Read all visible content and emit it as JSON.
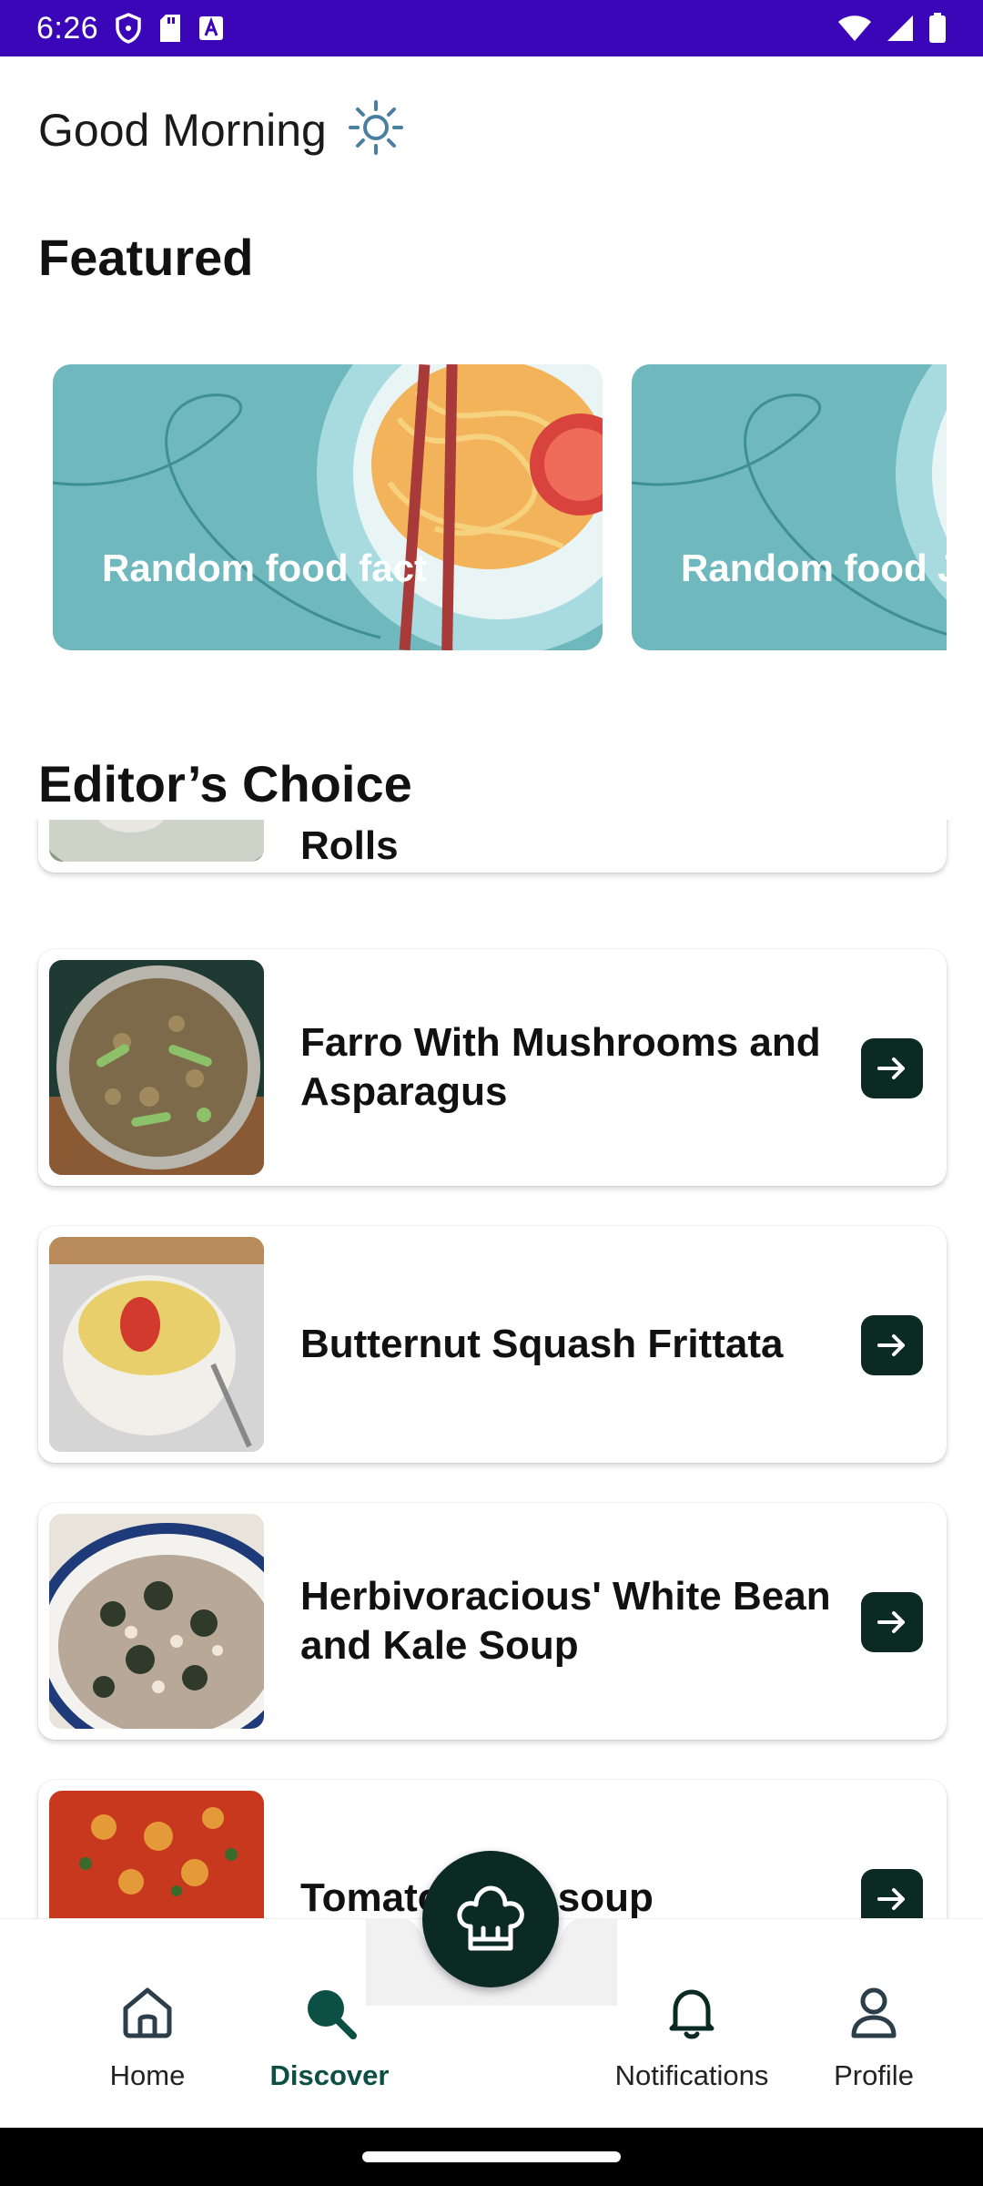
{
  "status_bar": {
    "time": "6:26"
  },
  "greeting": {
    "text": "Good Morning",
    "icon": "sun-icon"
  },
  "featured": {
    "title": "Featured",
    "cards": [
      {
        "label": "Random food fact"
      },
      {
        "label": "Random food J"
      }
    ]
  },
  "editors_choice": {
    "title": "Editor’s Choice",
    "recipes": [
      {
        "title": "Rolls"
      },
      {
        "title": "Farro With Mushrooms and Asparagus"
      },
      {
        "title": "Butternut Squash Frittata"
      },
      {
        "title": "Herbivoracious' White Bean and Kale Soup"
      },
      {
        "title": "Tomato lentil soup"
      }
    ]
  },
  "bottom_nav": {
    "items": [
      {
        "label": "Home",
        "icon": "home-icon"
      },
      {
        "label": "Discover",
        "icon": "search-icon",
        "active": true
      },
      {
        "label": "Notifications",
        "icon": "bell-icon"
      },
      {
        "label": "Profile",
        "icon": "profile-icon"
      }
    ],
    "fab_icon": "chef-hat-icon"
  },
  "colors": {
    "status_bar": "#3a06b8",
    "accent": "#0b2a24",
    "active_nav": "#0b4f45",
    "card_teal": "#6fb8bd"
  }
}
